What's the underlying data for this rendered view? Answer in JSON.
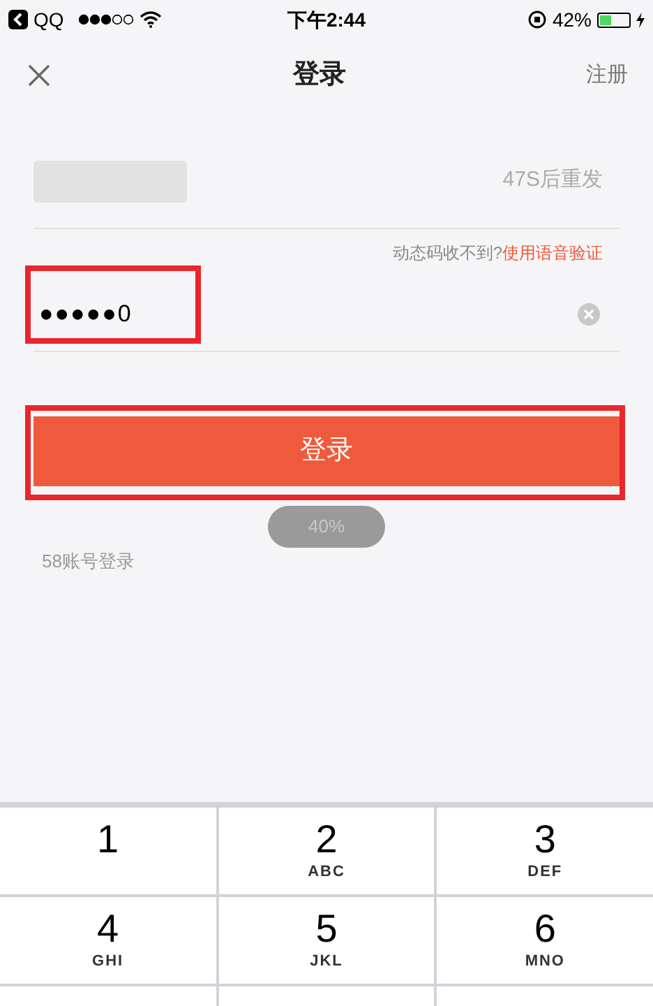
{
  "status_bar": {
    "back_app": "QQ",
    "time": "下午2:44",
    "battery": {
      "text": "42%",
      "level": 0.42
    }
  },
  "nav": {
    "title": "登录",
    "action": "注册"
  },
  "phone_row": {
    "countdown": "47S后重发"
  },
  "voice_hint": {
    "text": "动态码收不到?",
    "link": "使用语音验证"
  },
  "code_field": {
    "value": "●●●●●0"
  },
  "login_button": {
    "label": "登录"
  },
  "toast": {
    "text": "40%"
  },
  "alt_login": "58账号登录",
  "keypad": [
    {
      "digit": "1"
    },
    {
      "digit": "2",
      "letters": "ABC"
    },
    {
      "digit": "3",
      "letters": "DEF"
    },
    {
      "digit": "4",
      "letters": "GHI"
    },
    {
      "digit": "5",
      "letters": "JKL"
    },
    {
      "digit": "6",
      "letters": "MNO"
    }
  ]
}
